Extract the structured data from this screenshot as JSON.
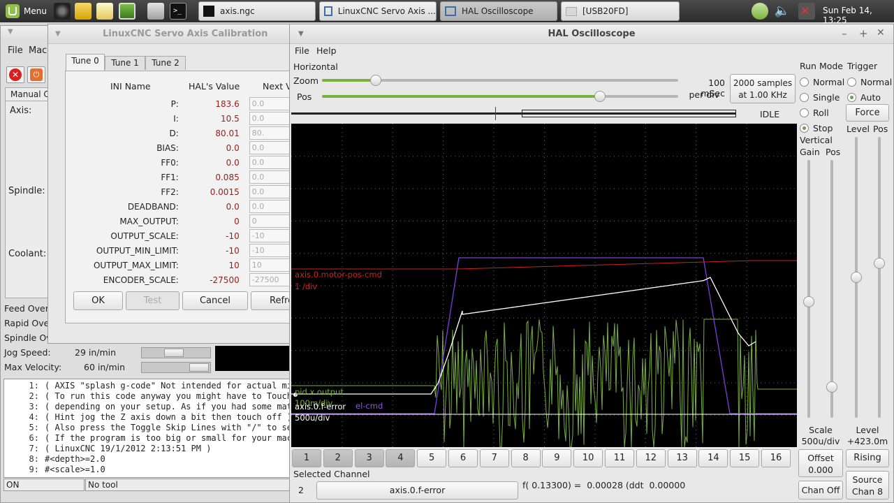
{
  "taskbar": {
    "menu_label": "Menu",
    "windows": [
      {
        "label": "axis.ngc"
      },
      {
        "label": "LinuxCNC Servo Axis ..."
      },
      {
        "label": "HAL Oscilloscope"
      },
      {
        "label": "[USB20FD]"
      }
    ],
    "clock": "Sun Feb 14, 13:25"
  },
  "axis_window": {
    "menus": [
      "File",
      "Mach"
    ],
    "tab_manual": "Manual C",
    "labels": {
      "axis": "Axis:",
      "spindle": "Spindle:",
      "coolant": "Coolant:"
    },
    "overrides": [
      "Feed Over",
      "Rapid Ove",
      "Spindle Ov"
    ],
    "jog_speed": {
      "label": "Jog Speed:",
      "value": "29 in/min"
    },
    "max_velocity": {
      "label": "Max Velocity:",
      "value": "60 in/min"
    },
    "gcode": [
      {
        "n": "1:",
        "t": "( AXIS \"splash g-code\" Not intended for actual mil"
      },
      {
        "n": "2:",
        "t": "( To run this code anyway you might have to Touch"
      },
      {
        "n": "3:",
        "t": "( depending on your setup. As if you had some mate"
      },
      {
        "n": "4:",
        "t": "( Hint jog the Z axis down a bit then touch off )"
      },
      {
        "n": "5:",
        "t": "( Also press the Toggle Skip Lines with \"/\" to see"
      },
      {
        "n": "6:",
        "t": "( If the program is too big or small for your mach"
      },
      {
        "n": "7:",
        "t": "( LinuxCNC 19/1/2012 2:13:51 PM )"
      },
      {
        "n": "8:",
        "t": "#<depth>=2.0"
      },
      {
        "n": "9:",
        "t": "#<scale>=1.0"
      }
    ],
    "status": {
      "state": "ON",
      "tool": "No tool"
    }
  },
  "calibration": {
    "title": "LinuxCNC Servo Axis Calibration",
    "tabs": [
      "Tune 0",
      "Tune 1",
      "Tune 2"
    ],
    "headers": {
      "name": "INI Name",
      "value": "HAL's Value",
      "next": "Next V"
    },
    "rows": [
      {
        "name": "P:",
        "value": "183.6",
        "next": "0.0"
      },
      {
        "name": "I:",
        "value": "10.5",
        "next": "0.0"
      },
      {
        "name": "D:",
        "value": "80.01",
        "next": "80."
      },
      {
        "name": "BIAS:",
        "value": "0.0",
        "next": "0.0"
      },
      {
        "name": "FF0:",
        "value": "0.0",
        "next": "0.0"
      },
      {
        "name": "FF1:",
        "value": "0.085",
        "next": "0.0"
      },
      {
        "name": "FF2:",
        "value": "0.0015",
        "next": "0.0"
      },
      {
        "name": "DEADBAND:",
        "value": "0.0",
        "next": "0.0"
      },
      {
        "name": "MAX_OUTPUT:",
        "value": "0",
        "next": "0"
      },
      {
        "name": "OUTPUT_SCALE:",
        "value": "-10",
        "next": "-10"
      },
      {
        "name": "OUTPUT_MIN_LIMIT:",
        "value": "-10",
        "next": "-10"
      },
      {
        "name": "OUTPUT_MAX_LIMIT:",
        "value": "10",
        "next": "10"
      },
      {
        "name": "ENCODER_SCALE:",
        "value": "-27500",
        "next": "-27500"
      }
    ],
    "buttons": {
      "ok": "OK",
      "test": "Test",
      "cancel": "Cancel",
      "refresh": "Refre"
    }
  },
  "scope": {
    "title": "HAL Oscilloscope",
    "menus": [
      "File",
      "Help"
    ],
    "horizontal": "Horizontal",
    "zoom_label": "Zoom",
    "pos_label": "Pos",
    "zoom_level": 0.15,
    "pos_level": 0.78,
    "time_div": "100 mSec",
    "per_div": "per div",
    "samples": "2000 samples",
    "rate": "at 1.00 KHz",
    "state": "IDLE",
    "run_mode": {
      "title": "Run Mode",
      "options": [
        "Normal",
        "Single",
        "Roll",
        "Stop"
      ],
      "selected": "Stop"
    },
    "trigger": {
      "title": "Trigger",
      "options": [
        "Normal",
        "Auto"
      ],
      "selected": "Auto",
      "force": "Force"
    },
    "vertical": {
      "title": "Vertical",
      "gain": "Gain",
      "pos": "Pos",
      "gain_level": 0.45,
      "pos_level": 0.12
    },
    "level_title": "Level",
    "level_pos": "Pos",
    "level_level": 0.5,
    "levelpos_level": 0.55,
    "scale": {
      "label": "Scale",
      "value": "500u/div"
    },
    "level": {
      "label": "Level",
      "value": "+423.0m"
    },
    "offset": {
      "label": "Offset",
      "value": "0.000"
    },
    "rising": "Rising",
    "chan_off": "Chan Off",
    "source": {
      "label": "Source",
      "value": "Chan 8"
    },
    "channels": [
      "1",
      "2",
      "3",
      "4",
      "5",
      "6",
      "7",
      "8",
      "9",
      "10",
      "11",
      "12",
      "13",
      "14",
      "15",
      "16"
    ],
    "active_channels": [
      1,
      2,
      3,
      4
    ],
    "selected_channel_label": "Selected Channel",
    "selected_channel_num": "2",
    "selected_channel_name": "axis.0.f-error",
    "readout": "f( 0.13300) =  0.00028 (ddt  0.00000",
    "trace_labels": [
      {
        "text": "axis.0.motor-pos-cmd",
        "color": "#cc2222"
      },
      {
        "text": "1 /div",
        "color": "#cc2222"
      },
      {
        "text": "pid.x.output",
        "color": "#7ab03e"
      },
      {
        "text": "100m/div",
        "color": "#7ab03e"
      },
      {
        "text": "axis.0.f-error",
        "color": "#ffffff"
      },
      {
        "text": "el-cmd",
        "color": "#8a55e0"
      },
      {
        "text": "500u/div",
        "color": "#ffffff"
      }
    ],
    "colors": {
      "ch1": "#cc2222",
      "ch2": "#ffffff",
      "ch3": "#7ab03e",
      "ch4": "#7a3fe0"
    }
  }
}
